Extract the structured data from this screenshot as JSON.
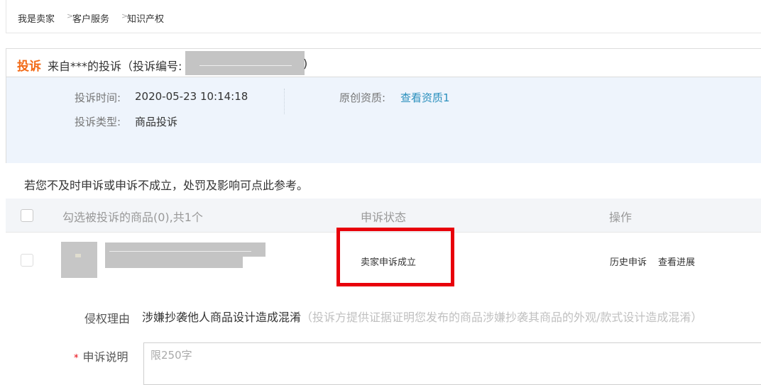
{
  "breadcrumb": {
    "items": [
      "我是卖家",
      "客户服务",
      "知识产权"
    ],
    "separator": ">"
  },
  "complaint": {
    "tag": "投诉",
    "from_text": "来自***的投诉（投诉编号:",
    "from_close": ")",
    "time_label": "投诉时间:",
    "time_value": "2020-05-23 10:14:18",
    "type_label": "投诉类型:",
    "type_value": "商品投诉",
    "qual_label": "原创资质:",
    "qual_link": "查看资质1"
  },
  "notice": "若您不及时申诉或申诉不成立，处罚及影响可点此参考。",
  "table": {
    "headers": {
      "select": "勾选被投诉的商品(0),共1个",
      "status": "申诉状态",
      "ops": "操作"
    },
    "rows": [
      {
        "status": "卖家申诉成立",
        "actions": [
          "历史申诉",
          "查看进展"
        ]
      }
    ]
  },
  "form": {
    "reason_label": "侵权理由",
    "reason_value": "涉嫌抄袭他人商品设计造成混淆",
    "reason_hint": "（投诉方提供证据证明您发布的商品涉嫌抄袭其商品的外观/款式设计造成混淆）",
    "explain_required": "*",
    "explain_label": "申诉说明",
    "explain_placeholder": "限250字"
  },
  "colors": {
    "accent_orange": "#f26a16",
    "link_blue": "#2a8fbd",
    "highlight_red": "#e8000b",
    "panel_bg": "#eef4fc"
  }
}
